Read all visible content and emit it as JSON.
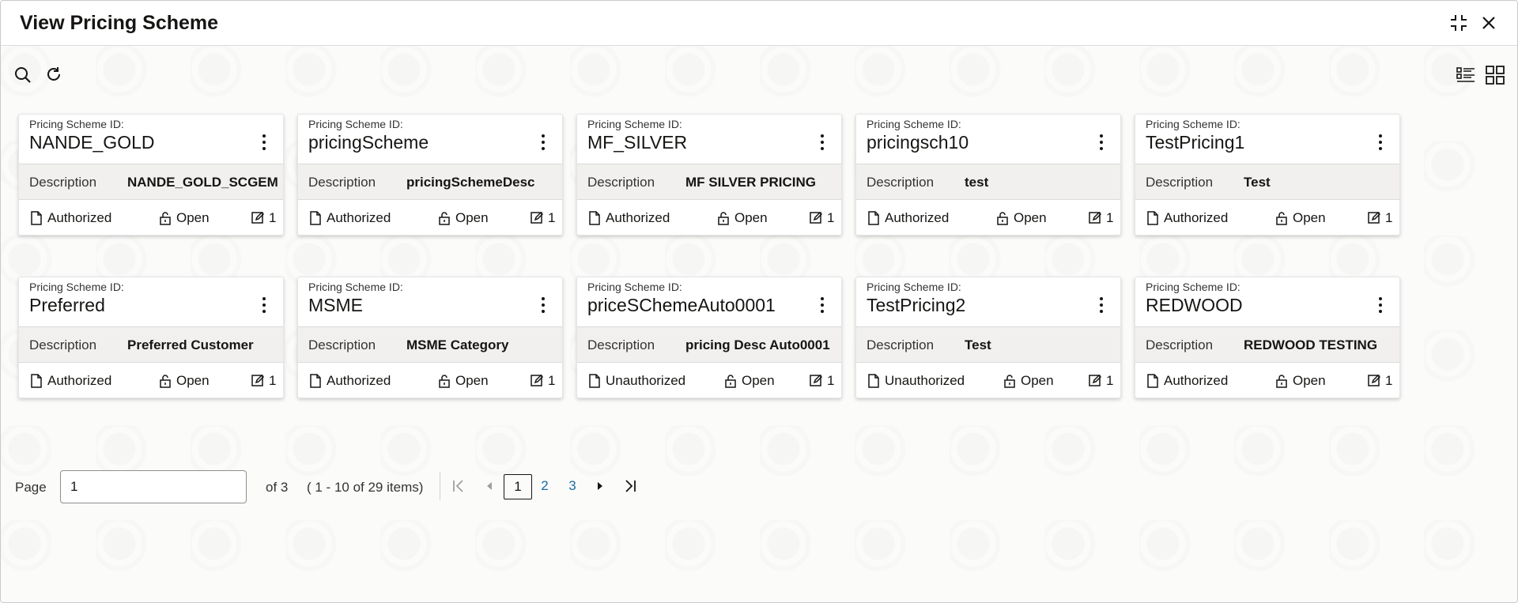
{
  "window": {
    "title": "View Pricing Scheme"
  },
  "toolbar": {
    "icons": [
      "search-icon",
      "refresh-icon",
      "list-view-icon",
      "grid-view-icon"
    ]
  },
  "card_labels": {
    "id_label": "Pricing Scheme ID:",
    "description_label": "Description"
  },
  "cards": [
    {
      "id": "NANDE_GOLD",
      "description": "NANDE_GOLD_SCGEME",
      "status": "Authorized",
      "lock": "Open",
      "version": "1"
    },
    {
      "id": "pricingScheme",
      "description": "pricingSchemeDesc",
      "status": "Authorized",
      "lock": "Open",
      "version": "1"
    },
    {
      "id": "MF_SILVER",
      "description": "MF SILVER PRICING",
      "status": "Authorized",
      "lock": "Open",
      "version": "1"
    },
    {
      "id": "pricingsch10",
      "description": "test",
      "status": "Authorized",
      "lock": "Open",
      "version": "1"
    },
    {
      "id": "TestPricing1",
      "description": "Test",
      "status": "Authorized",
      "lock": "Open",
      "version": "1"
    },
    {
      "id": "Preferred",
      "description": "Preferred Customer",
      "status": "Authorized",
      "lock": "Open",
      "version": "1"
    },
    {
      "id": "MSME",
      "description": "MSME Category",
      "status": "Authorized",
      "lock": "Open",
      "version": "1"
    },
    {
      "id": "priceSChemeAuto0001",
      "description": "pricing Desc Auto0001",
      "status": "Unauthorized",
      "lock": "Open",
      "version": "1"
    },
    {
      "id": "TestPricing2",
      "description": "Test",
      "status": "Unauthorized",
      "lock": "Open",
      "version": "1"
    },
    {
      "id": "REDWOOD",
      "description": "REDWOOD TESTING",
      "status": "Authorized",
      "lock": "Open",
      "version": "1"
    }
  ],
  "pagination": {
    "page_label": "Page",
    "page_value": "1",
    "of_text": "of 3",
    "items_text": "( 1 - 10 of 29 items)",
    "pages": [
      "1",
      "2",
      "3"
    ],
    "current_page": "1"
  }
}
